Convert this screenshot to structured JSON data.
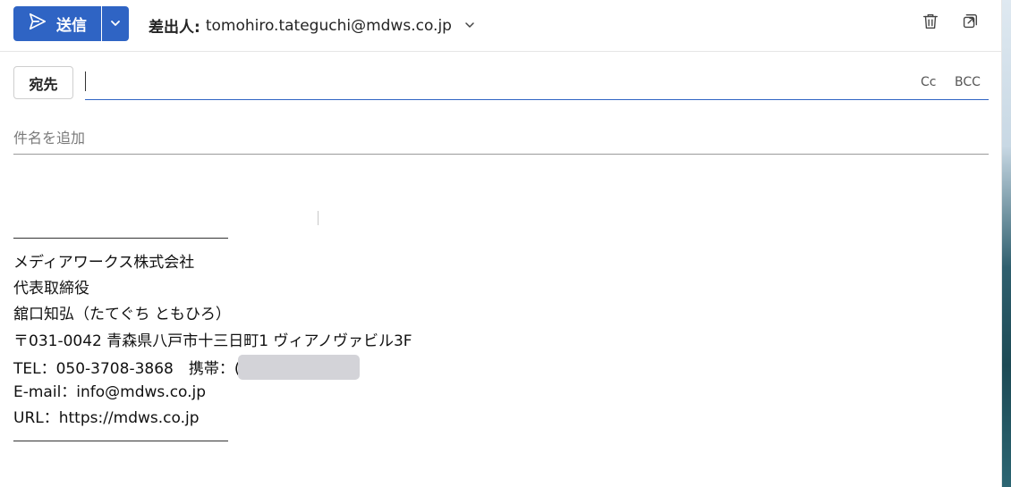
{
  "toolbar": {
    "send_label": "送信",
    "from_label": "差出人:",
    "from_address": "tomohiro.tateguchi@mdws.co.jp",
    "accent": "#2f64c4"
  },
  "recipients": {
    "to_label": "宛先",
    "to_value": "",
    "cc_label": "Cc",
    "bcc_label": "BCC"
  },
  "subject": {
    "placeholder": "件名を追加",
    "value": ""
  },
  "signature": {
    "lines": [
      "メディアワークス株式会社",
      "代表取締役",
      "舘口知弘（たてぐち ともひろ）",
      "〒031-0042 青森県八戸市十三日町1 ヴィアノヴァビル3F",
      "TEL：050-3708-3868　携帯：(",
      "E-mail：info@mdws.co.jp",
      "URL：https://mdws.co.jp"
    ]
  },
  "icons": [
    "send-icon",
    "chevron-down-icon",
    "trash-icon",
    "popout-icon"
  ]
}
